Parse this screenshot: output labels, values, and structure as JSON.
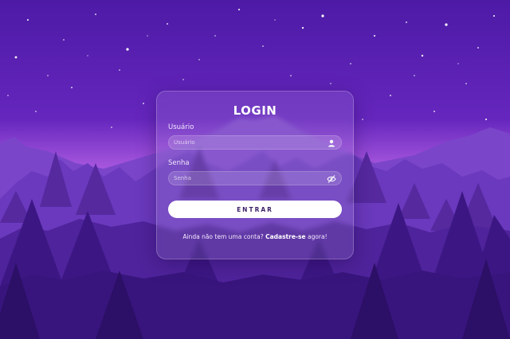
{
  "login": {
    "title": "LOGIN",
    "username": {
      "label": "Usuário",
      "placeholder": "Usuário",
      "value": "",
      "icon": "user-icon"
    },
    "password": {
      "label": "Senha",
      "placeholder": "Senha",
      "value": "",
      "icon": "eye-slash-icon"
    },
    "submit_label": "ENTRAR",
    "signup": {
      "prefix": "Ainda não tem uma conta?",
      "link": "Cadastre-se",
      "suffix": "agora!"
    }
  },
  "colors": {
    "sky_top": "#4d1aa6",
    "sky_mid": "#7f33d0",
    "horizon": "#c674e8",
    "mountains": "#7b45c9",
    "trees_far": "#6a39bd",
    "trees_mid": "#4f239b",
    "trees_near": "#38157d",
    "button_bg": "#ffffff"
  }
}
